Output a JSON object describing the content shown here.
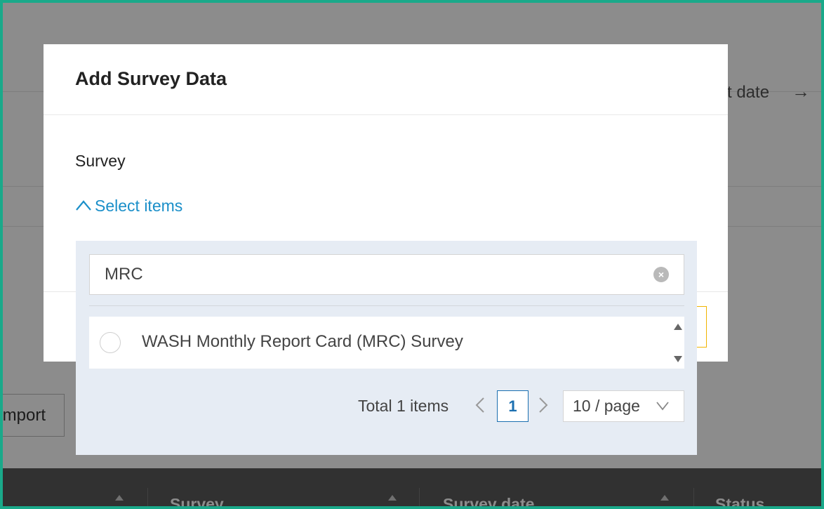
{
  "background": {
    "date_label": "t date",
    "import_button": "Import",
    "table_headers": [
      "Survey",
      "Survey date",
      "Status"
    ]
  },
  "modal": {
    "title": "Add Survey Data",
    "field_label": "Survey",
    "select_toggle_label": "Select items"
  },
  "dropdown": {
    "search": {
      "value": "MRC",
      "placeholder": ""
    },
    "items": [
      {
        "label": "WASH Monthly Report Card (MRC) Survey",
        "selected": false
      }
    ],
    "pagination": {
      "total_text": "Total 1 items",
      "current_page": "1",
      "page_size": "10 / page"
    }
  },
  "colors": {
    "accent": "#1b8fc9",
    "page_active": "#1b6fb0",
    "panel_bg": "#e6ecf4",
    "frame": "#1aa98a"
  },
  "icons": {
    "toggle": "chevron-up-icon",
    "clear": "clear-icon",
    "prev": "chevron-left-icon",
    "next": "chevron-right-icon",
    "page_size": "chevron-down-icon"
  }
}
